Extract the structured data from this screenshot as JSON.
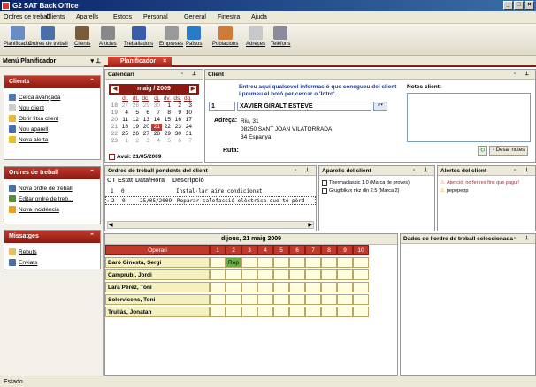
{
  "window": {
    "title": "G2 SAT Back Office",
    "app_icon": "app-logo-icon"
  },
  "menu": [
    "Ordres de treball",
    "Clients",
    "Aparells",
    "Estocs",
    "Personal",
    "General",
    "Finestra",
    "Ajuda"
  ],
  "toolbar": [
    {
      "label": "Planificador",
      "icon": "calendar-icon",
      "color": "#6a8cc4"
    },
    {
      "label": "Ordres de treball",
      "icon": "work-order-icon",
      "color": "#4a6ea8"
    },
    {
      "label": "Clients",
      "icon": "clients-icon",
      "color": "#7a5c3a"
    },
    {
      "label": "Articles",
      "icon": "articles-icon",
      "color": "#888888"
    },
    {
      "label": "Treballadors",
      "icon": "workers-icon",
      "color": "#3a5ca8"
    },
    {
      "label": "Empreses",
      "icon": "companies-icon",
      "color": "#9a9a9a"
    },
    {
      "label": "Països",
      "icon": "globe-icon",
      "color": "#2a7ac8"
    },
    {
      "label": "Poblacions",
      "icon": "house-icon",
      "color": "#d07a3a"
    },
    {
      "label": "Adreces",
      "icon": "address-icon",
      "color": "#c8c8c8"
    },
    {
      "label": "Telèfons",
      "icon": "phone-icon",
      "color": "#8a8a9a"
    }
  ],
  "left_panel": {
    "title": "Menú Planificador",
    "groups": [
      {
        "title": "Clients",
        "items": [
          {
            "label": "Cerca avançada",
            "icon": "search-icon",
            "color": "#4a7ab8"
          },
          {
            "label": "Nou client",
            "icon": "new-doc-icon",
            "color": "#cccccc"
          },
          {
            "label": "Obrir fitxa client",
            "icon": "open-folder-icon",
            "color": "#e8b840"
          },
          {
            "label": "Nou aparell",
            "icon": "device-icon",
            "color": "#4a6ea8"
          },
          {
            "label": "Nova alerta",
            "icon": "warning-icon",
            "color": "#e8c020"
          }
        ]
      },
      {
        "title": "Ordres de treball",
        "items": [
          {
            "label": "Nova ordre de treball",
            "icon": "work-order-icon",
            "color": "#4a6ea8"
          },
          {
            "label": "Editar ordre de treb...",
            "icon": "edit-icon",
            "color": "#5a8a3a"
          },
          {
            "label": "Nova incidència",
            "icon": "incident-icon",
            "color": "#e8a020"
          }
        ]
      },
      {
        "title": "Missatges",
        "items": [
          {
            "label": "Rebuts",
            "icon": "inbox-icon",
            "color": "#e8c060"
          },
          {
            "label": "Enviats",
            "icon": "sent-icon",
            "color": "#4a6ea8"
          }
        ]
      }
    ]
  },
  "tab": {
    "label": "Planificador",
    "close": "×"
  },
  "calendar": {
    "panel_title": "Calendari",
    "month": "maig / 2009",
    "day_headers": [
      "dl.",
      "dt.",
      "dc.",
      "dj.",
      "dv.",
      "ds.",
      "dg."
    ],
    "weeks": [
      {
        "n": "18",
        "days": [
          "27",
          "28",
          "29",
          "30",
          "1",
          "2",
          "3"
        ]
      },
      {
        "n": "19",
        "days": [
          "4",
          "5",
          "6",
          "7",
          "8",
          "9",
          "10"
        ]
      },
      {
        "n": "20",
        "days": [
          "11",
          "12",
          "13",
          "14",
          "15",
          "16",
          "17"
        ]
      },
      {
        "n": "21",
        "days": [
          "18",
          "19",
          "20",
          "21",
          "22",
          "23",
          "24"
        ]
      },
      {
        "n": "22",
        "days": [
          "25",
          "26",
          "27",
          "28",
          "29",
          "30",
          "31"
        ]
      },
      {
        "n": "23",
        "days": [
          "1",
          "2",
          "3",
          "4",
          "5",
          "6",
          "7"
        ]
      }
    ],
    "selected": "21",
    "today_label": "Avui: 21/05/2009"
  },
  "client": {
    "panel_title": "Client",
    "hint": "Entreu aquí qualsevol informació que conegueu del client i premeu el botó per cercar o 'Intro'.",
    "code": "1",
    "name": "XAVIER GIRALT ESTEVE",
    "adreca_label": "Adreça:",
    "address_lines": [
      "Riu, 31",
      "08250 SANT JOAN VILATORRADA",
      "34 Espanya"
    ],
    "ruta_label": "Ruta:",
    "notes_label": "Notes client:",
    "save_notes": "Desar notes"
  },
  "orders": {
    "panel_title": "Ordres de treball pendents del client",
    "columns": [
      "OT",
      "Estat",
      "Data/Hora",
      "Descripció"
    ],
    "rows": [
      {
        "ot": "1",
        "estat": "0",
        "data": "",
        "desc": "Instal·lar aire condicionat"
      },
      {
        "ot": "2",
        "estat": "0",
        "data": "25/05/2009",
        "desc": "Reparar calefacció elèctrica que té pèrd"
      }
    ]
  },
  "devices": {
    "panel_title": "Aparells del client",
    "items": [
      "Thermaclassic 1.0 (Marca de proves)",
      "Grugfblkvx nkz dln 2.5 (Marca 2)"
    ]
  },
  "alerts": {
    "panel_title": "Alertes del client",
    "items": [
      "Atenció: no fer res fins que pagui!",
      "pepepepp"
    ]
  },
  "schedule": {
    "date": "dijous, 21 maig 2009",
    "header": "Operari",
    "hours": [
      "1",
      "2",
      "3",
      "4",
      "5",
      "6",
      "7",
      "8",
      "9",
      "10"
    ],
    "operators": [
      {
        "name": "Baró Ginestà, Sergi",
        "tag": "Rep",
        "tag_hour": 1
      },
      {
        "name": "Camprubí, Jordi"
      },
      {
        "name": "Lara Pérez, Toni"
      },
      {
        "name": "Solervicens, Toni"
      },
      {
        "name": "Trullàs, Jonatan"
      }
    ]
  },
  "details": {
    "panel_title": "Dades de l'ordre de treball seleccionada"
  },
  "status": "Estado"
}
